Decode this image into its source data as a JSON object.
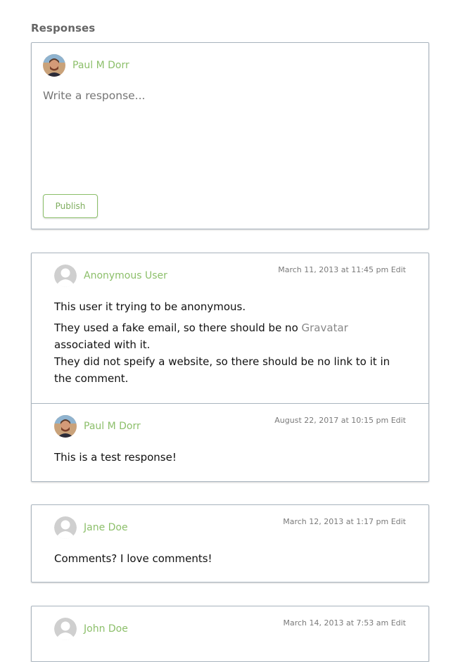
{
  "section": {
    "title": "Responses"
  },
  "composer": {
    "author": "Paul M Dorr",
    "placeholder": "Write a response...",
    "publish_label": "Publish"
  },
  "comments": [
    {
      "author": "Anonymous User",
      "date": "March 11, 2013 at 11:45 pm",
      "edit": "Edit",
      "body": {
        "line1": "This user it trying to be anonymous.",
        "line2_pre": "They used a fake email, so there should be no ",
        "line2_link": "Gravatar",
        "line2_post": " associated with it.",
        "line3": "They did not speify a website, so there should be no link to it in the comment."
      },
      "reply": {
        "author": "Paul M Dorr",
        "date": "August 22, 2017 at 10:15 pm",
        "edit": "Edit",
        "body": "This is a test response!"
      }
    },
    {
      "author": "Jane Doe",
      "date": "March 12, 2013 at 1:17 pm",
      "edit": "Edit",
      "body": "Comments? I love comments!"
    },
    {
      "author": "John Doe",
      "date": "March 14, 2013 at 7:53 am",
      "edit": "Edit"
    }
  ],
  "colors": {
    "accent": "#8cbf6a",
    "border": "#a9b4be",
    "meta": "#7a7a7a"
  },
  "icons": {
    "user_avatar": "user-photo-avatar",
    "default_avatar": "default-person-avatar"
  }
}
